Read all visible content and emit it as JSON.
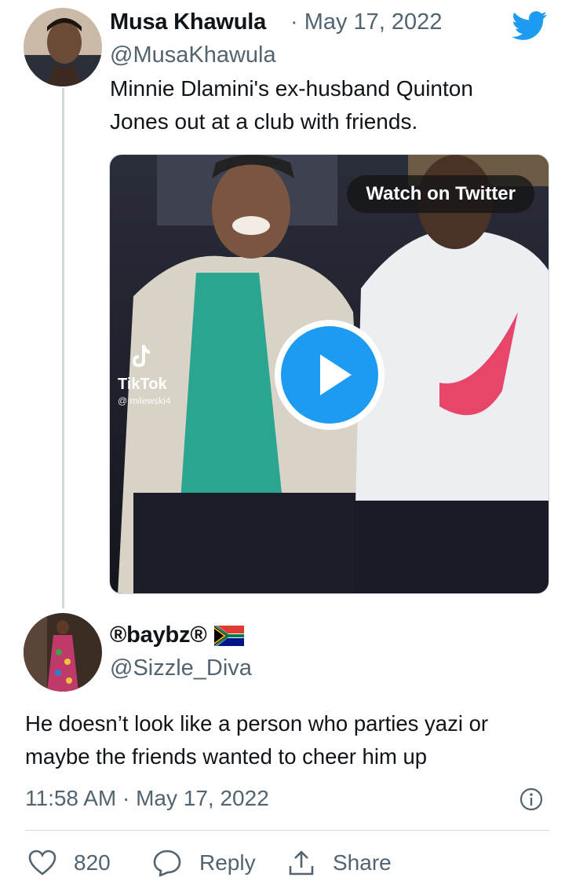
{
  "original_tweet": {
    "author_name": "Musa Khawula",
    "date": "· May 17, 2022",
    "handle": "@MusaKhawula",
    "text_line1": "Minnie Dlamini's ex-husband Quinton",
    "text_line2": "Jones out at a club with friends.",
    "media": {
      "watch_label": "Watch on Twitter",
      "tiktok_label": "TikTok",
      "tiktok_user": "@ milewski4"
    }
  },
  "reply_tweet": {
    "author_name": "®baybz®",
    "handle": "@Sizzle_Diva",
    "text_line1": "He doesn’t look like a person who parties yazi or",
    "text_line2": "maybe the friends wanted to cheer him up",
    "timestamp": "11:58 AM · May 17, 2022"
  },
  "actions": {
    "likes": "820",
    "reply_label": "Reply",
    "share_label": "Share"
  },
  "colors": {
    "twitter_blue": "#1d9bf0",
    "secondary_text": "#536471",
    "divider": "#cfd9de"
  },
  "icons": [
    "twitter-bird-icon",
    "play-icon",
    "tiktok-logo-icon",
    "south-africa-flag-icon",
    "info-icon",
    "heart-icon",
    "reply-bubble-icon",
    "share-icon"
  ]
}
